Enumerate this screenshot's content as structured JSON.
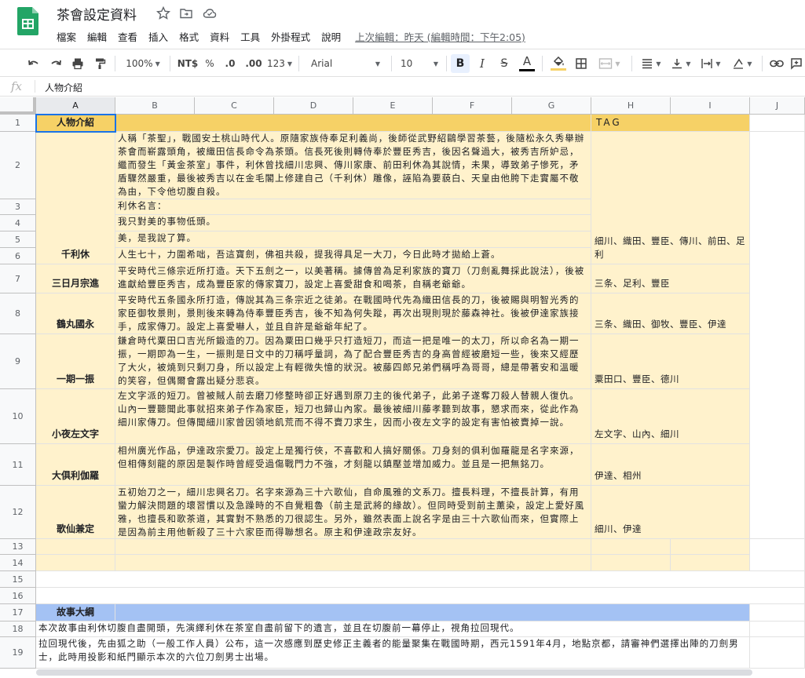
{
  "doc": {
    "title": "茶會設定資料",
    "menus": [
      "檔案",
      "編輯",
      "查看",
      "插入",
      "格式",
      "資料",
      "工具",
      "外掛程式",
      "說明"
    ],
    "last_edit": "上次編輯：昨天 (編輯時間：下午2:05)"
  },
  "toolbar": {
    "zoom": "100%",
    "currency": "NT$",
    "percent": "%",
    "decimal_decrease": ".0",
    "decimal_increase": ".00",
    "number_format": "123",
    "font": "Arial",
    "font_size": "10",
    "bold": "B",
    "italic": "I",
    "strike": "S",
    "text_color": "A",
    "text_color_hex": "#000000",
    "fill_color_hex": "#f6d166"
  },
  "formula": {
    "fx": "fx",
    "value": "人物介紹"
  },
  "columns": [
    "A",
    "B",
    "C",
    "D",
    "E",
    "F",
    "G",
    "H",
    "I",
    "J"
  ],
  "rows": [
    "1",
    "2",
    "3",
    "4",
    "5",
    "6",
    "7",
    "8",
    "9",
    "10",
    "11",
    "12",
    "13",
    "14",
    "15",
    "16",
    "17",
    "18",
    "19"
  ],
  "sheet": {
    "header_a": "人物介紹",
    "header_tag": "TAG",
    "r2_desc": "人稱「茶聖」，戰國安土桃山時代人。原隨家族侍奉足利義尚，後師從武野紹鷗學習茶藝，後隨松永久秀舉辦茶會而嶄露頭角，被織田信長命令為茶頭。信長死後則轉侍奉於豐臣秀吉，後因名聲過大，被秀吉所妒忌，繼而發生「黃金茶室」事件，利休曾找細川忠興、傳川家康、前田利休為其說情，未果，導致弟子慘死，矛盾驟然嚴重，最後被秀吉以在金毛閣上修建自己（千利休）雕像，誣陷為要藐白、天皇由他胯下走實屬不敬為由，下令他切腹自殺。",
    "r3": "利休名言：",
    "r4": "我只對美的事物低頭。",
    "r5": "美，是我說了算。",
    "r6": "人生七十，力圍希咄，吾這寶劍，佛祖共殺，提我得具足一大刀，今日此時才拋給上蒼。",
    "characters": [
      {
        "name": "千利休",
        "tags": "細川、織田、豐臣、傳川、前田、足利"
      },
      {
        "name": "三日月宗進",
        "desc": "平安時代三條宗近所打造。天下五劍之一，以美著稱。據傳曾為足利家族的寶刀（刀劍亂舞採此說法），後被進獻給豐臣秀吉，成為豐臣家的傳家寶刀，設定上喜愛甜食和喝茶，自稱老爺爺。",
        "tags": "三条、足利、豐臣"
      },
      {
        "name": "鶴丸國永",
        "desc": "平安時代五条國永所打造，傳說其為三条宗近之徒弟。在戰國時代先為織田信長的刀，後被賜與明智光秀的家臣御牧景則，景則後來轉為侍奉豐臣秀吉，後不知為何失蹤，再次出現則現於藤森神社。後被伊達家族接手，成家傳刀。設定上喜愛嚇人，並且自許是爺爺年紀了。",
        "tags": "三条、織田、御牧、豐臣、伊達"
      },
      {
        "name": "一期一振",
        "desc": "鎌倉時代粟田口吉光所鍛造的刀。因為粟田口幾乎只打造短刀，而這一把是唯一的太刀，所以命名為一期一振，一期即為一生，一振則是日文中的刀稱呼量詞，為了配合豐臣秀吉的身高曾經被磨短一些，後來又經歷了大火，被燒到只剩刀身，所以設定上有輕微失憶的狀況。被藤四郎兄弟們稱呼為哥哥，總是帶著安和溫暖的笑容，但偶爾會露出疑分悲哀。",
        "tags": "粟田口、豐臣、德川"
      },
      {
        "name": "小夜左文字",
        "desc": "左文字派的短刀。曾被賊人前去磨刀修整時卻正好遇到原刀主的後代弟子，此弟子遂奪刀殺人替親人復仇。山內一豐聽聞此事就招來弟子作為家臣，短刀也歸山內家。最後被細川藤孝聽到故事，懇求而來，從此作為細川家傳刀。但傳聞細川家曾因領地飢荒而不得不賣刀求生，因而小夜左文字的設定有害怕被賣掉一說。",
        "tags": "左文字、山內、細川"
      },
      {
        "name": "大俱利伽羅",
        "desc": "相州廣光作品，伊達政宗愛刀。設定上是獨行俠，不喜歡和人搞好關係。刀身刻的俱利伽羅龍是名字來源，但相傳刻龍的原因是製作時曾經受過傷戰門力不強，才刻龍以鎮壓並增加威力。並且是一把無銘刀。",
        "tags": "伊達、相州"
      },
      {
        "name": "歌仙兼定",
        "desc": "五初始刀之一，細川忠興名刀。名字來源為三十六歌仙，自命風雅的文系刀。擅長料理，不擅長計算，有用蠻力解決問題的壞習慣以及急躁時的不自覺粗魯（前主是武將的緣故）。但同時受到前主薰染，設定上愛好風雅，也擅長和歌茶道，其實對不熟悉的刀很認生。另外，雖然表面上說名字是由三十六歌仙而來，但實際上是因為前主用他斬殺了三十六家臣而得聯想名。原主和伊達政宗友好。",
        "tags": "細川、伊達"
      }
    ],
    "story_header": "故事大綱",
    "r18": "本次故事由利休切腹自盡開頭，先演繹利休在茶室自盡前留下的遺言，並且在切腹前一幕停止，視角拉回現代。",
    "r19": "拉回現代後，先由狐之助（一般工作人員）公布，這一次感應到歷史修正主義者的能量聚集在戰國時期，西元1591年4月，地點京都，請審神們選擇出陣的刀劍男士，此時用投影和紙門顯示本次的六位刀劍男士出場。"
  },
  "colors": {
    "header_gold": "#f6d166",
    "body_yellow": "#fff2cc",
    "story_blue": "#a4c2f4",
    "selection": "#1a73e8"
  }
}
